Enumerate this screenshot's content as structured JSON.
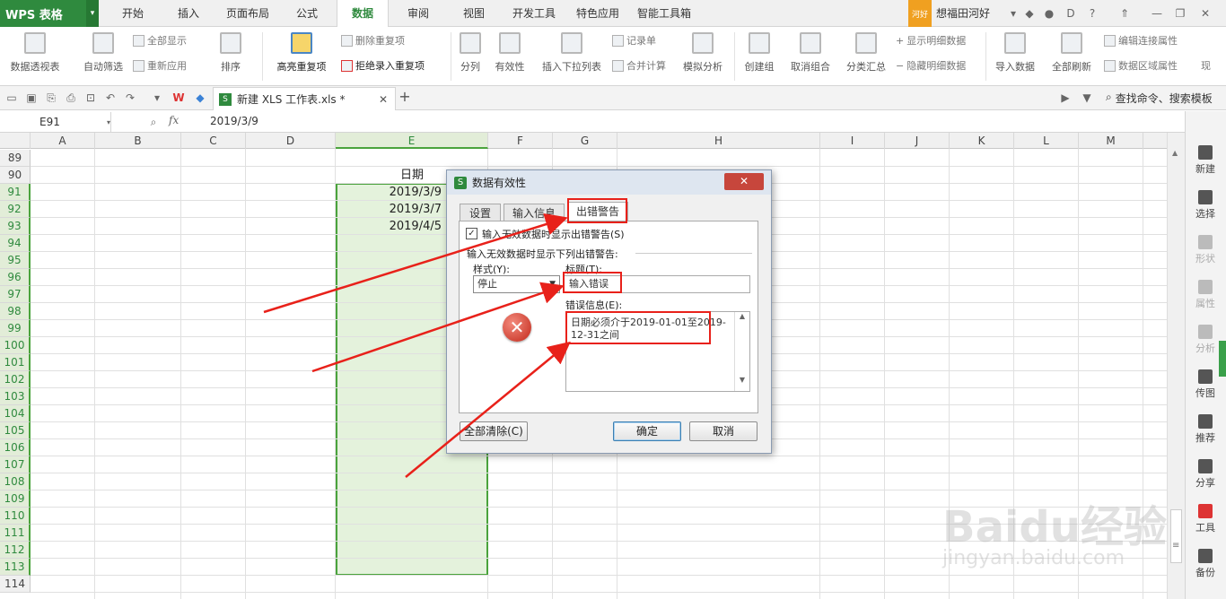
{
  "app": {
    "brand": "WPS 表格",
    "user_badge": "河好",
    "user_name": "想福田河好"
  },
  "menu": [
    {
      "label": "开始",
      "active": false
    },
    {
      "label": "插入",
      "active": false
    },
    {
      "label": "页面布局",
      "active": false
    },
    {
      "label": "公式",
      "active": false
    },
    {
      "label": "数据",
      "active": true
    },
    {
      "label": "审阅",
      "active": false
    },
    {
      "label": "视图",
      "active": false
    },
    {
      "label": "开发工具",
      "active": false
    },
    {
      "label": "特色应用",
      "active": false
    },
    {
      "label": "智能工具箱",
      "active": false
    }
  ],
  "ribbon": {
    "pivot": "数据透视表",
    "autofilter": "自动筛选",
    "show_all": "全部显示",
    "reapply": "重新应用",
    "sort": "排序",
    "highlight_dup": "高亮重复项",
    "remove_dup": "删除重复项",
    "reject_dup": "拒绝录入重复项",
    "split": "分列",
    "validity": "有效性",
    "insert_dropdown": "插入下拉列表",
    "record": "记录单",
    "consolidate": "合并计算",
    "what_if": "模拟分析",
    "group": "创建组",
    "ungroup": "取消组合",
    "subtotal": "分类汇总",
    "show_detail": "显示明细数据",
    "hide_detail": "隐藏明细数据",
    "import": "导入数据",
    "refresh_all": "全部刷新",
    "edit_conn": "编辑连接属性",
    "range_prop": "数据区域属性",
    "more": "现"
  },
  "doc_tab": {
    "title": "新建 XLS 工作表.xls *"
  },
  "command_search": "查找命令、搜索模板",
  "formula_bar": {
    "cell_ref": "E91",
    "fx": "fx",
    "value": "2019/3/9"
  },
  "columns": [
    "A",
    "B",
    "C",
    "D",
    "E",
    "F",
    "G",
    "H",
    "I",
    "J",
    "K",
    "L",
    "M"
  ],
  "rows": [
    "89",
    "90",
    "91",
    "92",
    "93",
    "94",
    "95",
    "96",
    "97",
    "98",
    "99",
    "100",
    "101",
    "102",
    "103",
    "104",
    "105",
    "106",
    "107",
    "108",
    "109",
    "110",
    "111",
    "112",
    "113",
    "114"
  ],
  "cells": {
    "header": "日期",
    "d1": "2019/3/9",
    "d2": "2019/3/7",
    "d3": "2019/4/5"
  },
  "right_panel": [
    "新建",
    "选择",
    "形状",
    "属性",
    "分析",
    "传图",
    "推荐",
    "分享",
    "工具",
    "备份"
  ],
  "dialog": {
    "title": "数据有效性",
    "close": "✕",
    "tabs": [
      "设置",
      "输入信息",
      "出错警告"
    ],
    "show_alert_label": "输入无效数据时显示出错警告(S)",
    "show_alert_checked": true,
    "section_label": "输入无效数据时显示下列出错警告:",
    "style_label": "样式(Y):",
    "style_value": "停止",
    "title_label": "标题(T):",
    "title_value": "输入错误",
    "message_label": "错误信息(E):",
    "message_value": "日期必须介于2019-01-01至2019-12-31之间",
    "clear_all": "全部清除(C)",
    "ok": "确定",
    "cancel": "取消"
  },
  "watermark": {
    "brand": "Baidu经验",
    "url": "jingyan.baidu.com"
  },
  "colors": {
    "accent": "#2f8a3e",
    "annotation": "#e8211a",
    "selection": "#e4f2dc"
  }
}
